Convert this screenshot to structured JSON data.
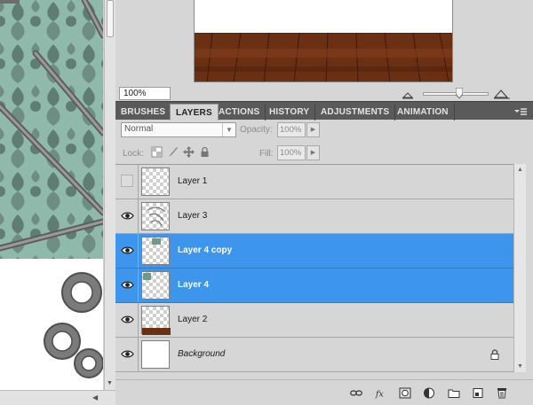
{
  "navigator": {
    "zoom_value": "100%"
  },
  "panel": {
    "tabs": [
      {
        "label": "BRUSHES",
        "active": false
      },
      {
        "label": "LAYERS",
        "active": true
      },
      {
        "label": "ACTIONS",
        "active": false
      },
      {
        "label": "HISTORY",
        "active": false
      },
      {
        "label": "ADJUSTMENTS",
        "active": false
      },
      {
        "label": "ANIMATION",
        "active": false
      }
    ],
    "menu_icon": "panel-menu-icon"
  },
  "controls": {
    "blend_mode": "Normal",
    "opacity_label": "Opacity:",
    "opacity_value": "100%",
    "lock_label": "Lock:",
    "lock_icons": [
      "lock-transparent-icon",
      "lock-paint-icon",
      "lock-move-icon",
      "lock-all-icon"
    ],
    "fill_label": "Fill:",
    "fill_value": "100%"
  },
  "layers": [
    {
      "name": "Layer 1",
      "visible": false,
      "selected": false,
      "italic": false,
      "locked": false
    },
    {
      "name": "Layer 3",
      "visible": true,
      "selected": false,
      "italic": false,
      "locked": false
    },
    {
      "name": "Layer 4 copy",
      "visible": true,
      "selected": true,
      "italic": false,
      "locked": false
    },
    {
      "name": "Layer 4",
      "visible": true,
      "selected": true,
      "italic": false,
      "locked": false
    },
    {
      "name": "Layer 2",
      "visible": true,
      "selected": false,
      "italic": false,
      "locked": false
    },
    {
      "name": "Background",
      "visible": true,
      "selected": false,
      "italic": true,
      "locked": true
    }
  ],
  "footer_icons": [
    "link-layers-icon",
    "fx-icon",
    "add-mask-icon",
    "adjustment-layer-icon",
    "new-group-icon",
    "new-layer-icon",
    "delete-layer-icon"
  ],
  "colors": {
    "selection": "#3d95ec",
    "tab_bar": "#5a5a5a",
    "panel_bg": "#d6d6d6",
    "damask_bg": "#8fb9aa",
    "damask_pattern": "#5f7d73",
    "floor_wood": "#6b2f14"
  }
}
